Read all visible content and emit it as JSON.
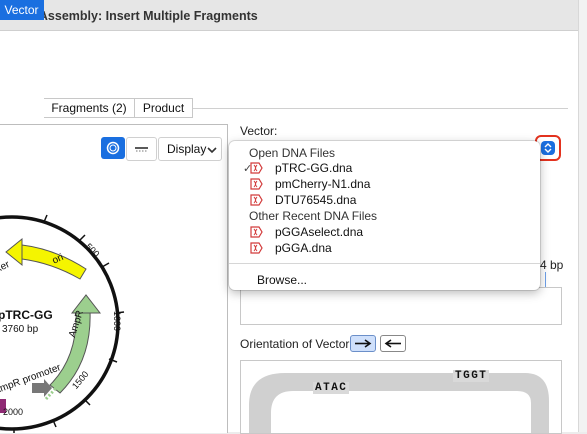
{
  "window": {
    "title": "n Gate Assembly: Insert Multiple Fragments"
  },
  "tabs": [
    {
      "label": "Vector",
      "active": true
    },
    {
      "label": "Fragments (2)",
      "active": false
    },
    {
      "label": "Product",
      "active": false
    }
  ],
  "toolbar": {
    "display_label": "Display"
  },
  "map": {
    "name": "pTRC-GG",
    "size": "3760 bp",
    "features": {
      "ori": "ori",
      "ampr": "AmpR",
      "ampr_promoter": "AmpR promoter",
      "left_partial": "ker",
      "left_partial2": "mpR"
    },
    "ticks": {
      "t500": "500",
      "t1000": "1000",
      "t1500": "1500",
      "t2000": "2000"
    }
  },
  "vector": {
    "label": "Vector:",
    "menu": {
      "open_header": "Open DNA Files",
      "open_items": [
        {
          "label": "pTRC-GG.dna",
          "checked": true
        },
        {
          "label": "pmCherry-N1.dna",
          "checked": false
        },
        {
          "label": "DTU76545.dna",
          "checked": false
        }
      ],
      "recent_header": "Other Recent DNA Files",
      "recent_items": [
        {
          "label": "pGGAselect.dna"
        },
        {
          "label": "pGGA.dna"
        }
      ],
      "browse_label": "Browse..."
    }
  },
  "bp_suffix": "4 bp",
  "orientation": {
    "label": "Orientation of Vector:",
    "forward_selected": true
  },
  "sequence": {
    "top_right": "TGGT",
    "left": "ATAC"
  },
  "colors": {
    "accent": "#1a6fe0",
    "highlight": "#e3321e",
    "ori": "#f5f500",
    "ampr": "#9ccf8e",
    "promoter": "#777777",
    "feature_magenta": "#8e2a73"
  }
}
